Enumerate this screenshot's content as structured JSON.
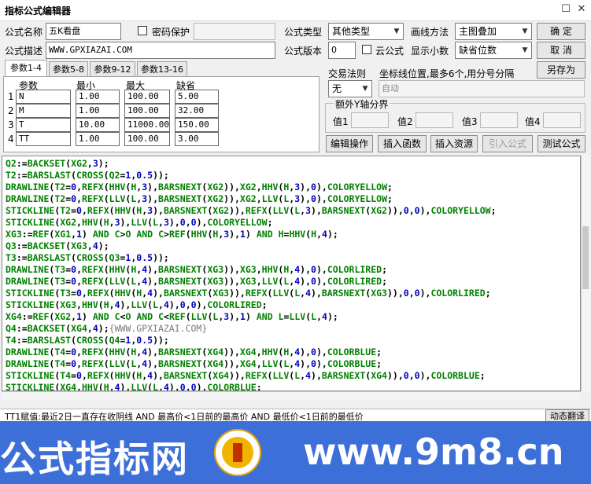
{
  "window": {
    "title": "指标公式编辑器"
  },
  "form": {
    "name_label": "公式名称",
    "name_value": "五K看盘",
    "password_label": "密码保护",
    "password_value": "",
    "desc_label": "公式描述",
    "desc_value": "WWW.GPXIAZAI.COM",
    "type_label": "公式类型",
    "type_value": "其他类型",
    "draw_method_label": "画线方法",
    "draw_method_value": "主图叠加",
    "version_label": "公式版本",
    "version_value": "0",
    "cloud_label": "云公式",
    "decimals_label": "显示小数",
    "decimals_value": "缺省位数",
    "trade_rule_label": "交易法则",
    "trade_rule_value": "无",
    "axis_label": "坐标线位置,最多6个,用分号分隔",
    "axis_value": "自动",
    "y_axis_group": "额外Y轴分界",
    "y_labels": [
      "值1",
      "值2",
      "值3",
      "值4"
    ]
  },
  "buttons": {
    "ok": "确 定",
    "cancel": "取 消",
    "save_as": "另存为",
    "edit_op": "编辑操作",
    "insert_func": "插入函数",
    "insert_res": "插入资源",
    "import_formula": "引入公式",
    "test_formula": "测试公式",
    "dynamic_translate": "动态翻译"
  },
  "tabs": [
    "参数1-4",
    "参数5-8",
    "参数9-12",
    "参数13-16"
  ],
  "params": {
    "headers": [
      "参数",
      "最小",
      "最大",
      "缺省"
    ],
    "rows": [
      {
        "idx": "1",
        "name": "N",
        "min": "1.00",
        "max": "100.00",
        "def": "5.00"
      },
      {
        "idx": "2",
        "name": "M",
        "min": "1.00",
        "max": "100.00",
        "def": "32.00"
      },
      {
        "idx": "3",
        "name": "T",
        "min": "10.00",
        "max": "11000.00",
        "def": "150.00"
      },
      {
        "idx": "4",
        "name": "TT",
        "min": "1.00",
        "max": "100.00",
        "def": "3.00"
      }
    ]
  },
  "code_lines": [
    "Q2:=BACKSET(XG2,3);",
    "T2:=BARSLAST(CROSS(Q2=1,0.5));",
    "DRAWLINE(T2=0,REFX(HHV(H,3),BARSNEXT(XG2)),XG2,HHV(H,3),0),COLORYELLOW;",
    "DRAWLINE(T2=0,REFX(LLV(L,3),BARSNEXT(XG2)),XG2,LLV(L,3),0),COLORYELLOW;",
    "STICKLINE(T2=0,REFX(HHV(H,3),BARSNEXT(XG2)),REFX(LLV(L,3),BARSNEXT(XG2)),0,0),COLORYELLOW;",
    "STICKLINE(XG2,HHV(H,3),LLV(L,3),0,0),COLORYELLOW;",
    "XG3:=REF(XG1,1) AND C>O AND C>REF(HHV(H,3),1) AND H=HHV(H,4);",
    "Q3:=BACKSET(XG3,4);",
    "T3:=BARSLAST(CROSS(Q3=1,0.5));",
    "DRAWLINE(T3=0,REFX(HHV(H,4),BARSNEXT(XG3)),XG3,HHV(H,4),0),COLORLIRED;",
    "DRAWLINE(T3=0,REFX(LLV(L,4),BARSNEXT(XG3)),XG3,LLV(L,4),0),COLORLIRED;",
    "STICKLINE(T3=0,REFX(HHV(H,4),BARSNEXT(XG3)),REFX(LLV(L,4),BARSNEXT(XG3)),0,0),COLORLIRED;",
    "STICKLINE(XG3,HHV(H,4),LLV(L,4),0,0),COLORLIRED;",
    "XG4:=REF(XG2,1) AND C<O AND C<REF(LLV(L,3),1) AND L=LLV(L,4);",
    "Q4:=BACKSET(XG4,4);{WWW.GPXIAZAI.COM}",
    "T4:=BARSLAST(CROSS(Q4=1,0.5));",
    "DRAWLINE(T4=0,REFX(HHV(H,4),BARSNEXT(XG4)),XG4,HHV(H,4),0),COLORBLUE;",
    "DRAWLINE(T4=0,REFX(LLV(L,4),BARSNEXT(XG4)),XG4,LLV(L,4),0),COLORBLUE;",
    "STICKLINE(T4=0,REFX(HHV(H,4),BARSNEXT(XG4)),REFX(LLV(L,4),BARSNEXT(XG4)),0,0),COLORBLUE;",
    "STICKLINE(XG4,HHV(H,4),LLV(L,4),0,0),COLORBLUE;"
  ],
  "status_text": "TT1赋值:最近2日一直存在收阴线 AND 最高价<1日前的最高价 AND 最低价<1日前的最低价",
  "banner": {
    "left": "公式指标网",
    "right": "www.9m8.cn"
  },
  "colors": {
    "code_green": "#008000",
    "code_blue": "#0000c0",
    "code_comment": "#7a7a7a",
    "banner_bg": "#3d6fd8"
  }
}
